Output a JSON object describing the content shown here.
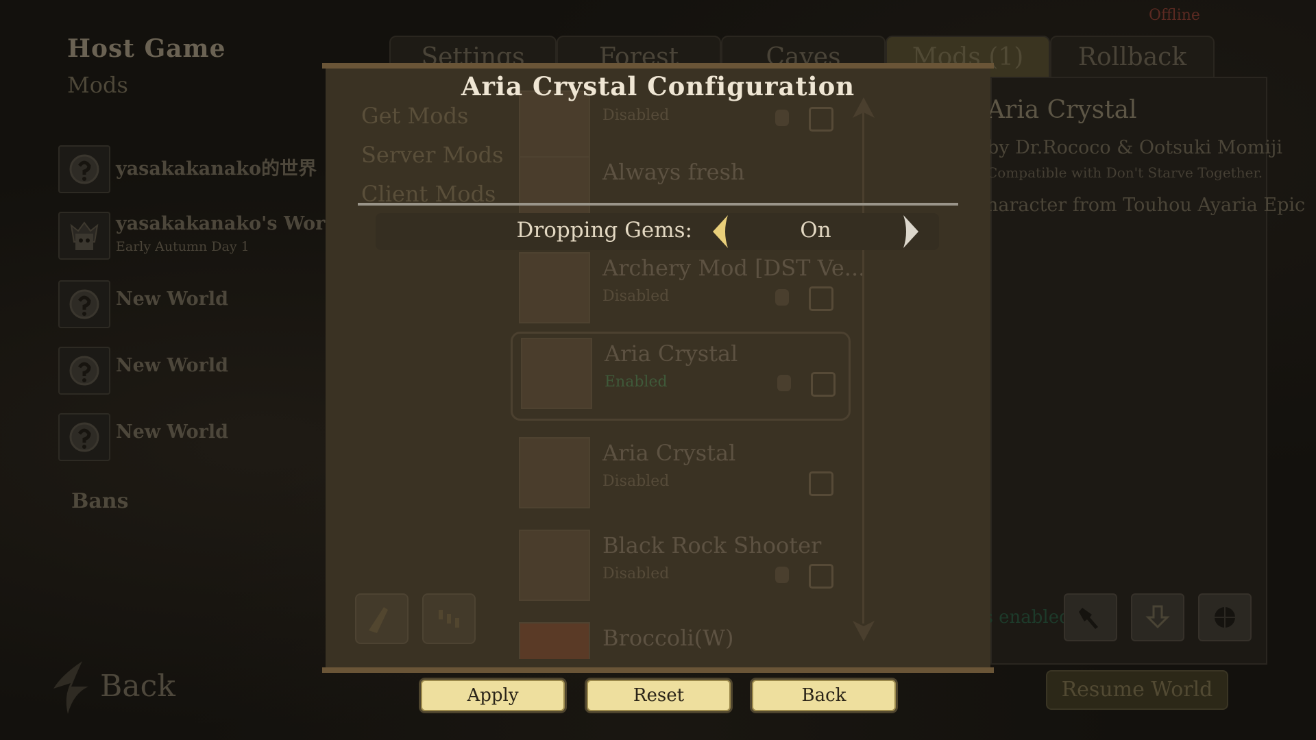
{
  "status": {
    "offline": "Offline"
  },
  "left": {
    "title": "Host Game",
    "subtitle": "Mods",
    "slots": [
      {
        "name": "yasakakanako的世界",
        "day": ""
      },
      {
        "name": "yasakakanako's World",
        "day": "Early Autumn Day 1"
      },
      {
        "name": "New World",
        "day": ""
      },
      {
        "name": "New World",
        "day": ""
      },
      {
        "name": "New World",
        "day": ""
      }
    ],
    "bans": "Bans",
    "back": "Back"
  },
  "tabs": [
    {
      "label": "Settings"
    },
    {
      "label": "Forest"
    },
    {
      "label": "Caves"
    },
    {
      "label": "Mods (1)"
    },
    {
      "label": "Rollback"
    }
  ],
  "mods_menu": [
    "Get Mods",
    "Server Mods",
    "Client Mods"
  ],
  "mod_list": [
    {
      "title": "",
      "status": "Disabled"
    },
    {
      "title": "Always fresh",
      "status": "Disabled"
    },
    {
      "title": "Archery Mod [DST Ve...",
      "status": "Disabled"
    },
    {
      "title": "Aria Crystal",
      "status": "Enabled"
    },
    {
      "title": "Aria Crystal",
      "status": "Disabled"
    },
    {
      "title": "Black Rock Shooter",
      "status": "Disabled"
    },
    {
      "title": "Broccoli(W)",
      "status": ""
    }
  ],
  "mod_detail": {
    "name": "Aria Crystal",
    "author": "by Dr.Rococo & Ootsuki Momiji",
    "compat": "Compatible with Don't Starve Together.",
    "description": "Original Character from Touhou Ayaria Epic",
    "enabled_text": "This mod is enabled.",
    "resume": "Resume World"
  },
  "dialog": {
    "title": "Aria Crystal Configuration",
    "option_label": "Dropping Gems:",
    "option_value": "On",
    "buttons": {
      "apply": "Apply",
      "reset": "Reset",
      "back": "Back"
    }
  },
  "colors": {
    "accent": "#eedf9e",
    "dialog_bg": "#3a3223",
    "text_light": "#efe6d4"
  }
}
